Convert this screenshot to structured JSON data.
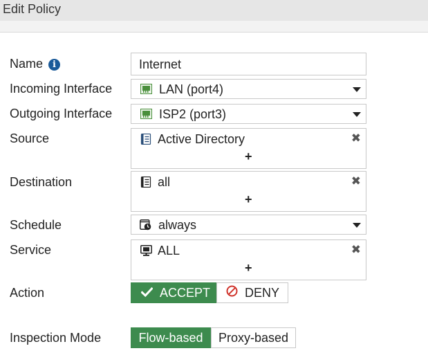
{
  "window": {
    "title": "Edit Policy"
  },
  "form": {
    "name": {
      "label": "Name",
      "icon": "info-icon",
      "value": "Internet"
    },
    "incoming_interface": {
      "label": "Incoming Interface",
      "icon": "network-port-icon",
      "value": "LAN (port4)"
    },
    "outgoing_interface": {
      "label": "Outgoing Interface",
      "icon": "network-port-icon",
      "value": "ISP2 (port3)"
    },
    "source": {
      "label": "Source",
      "icon": "address-book-icon",
      "value": "Active Directory",
      "add_label": "+",
      "remove_label": "✖"
    },
    "destination": {
      "label": "Destination",
      "icon": "address-book-icon",
      "value": "all",
      "add_label": "+",
      "remove_label": "✖"
    },
    "schedule": {
      "label": "Schedule",
      "icon": "schedule-clock-icon",
      "value": "always"
    },
    "service": {
      "label": "Service",
      "icon": "service-monitor-icon",
      "value": "ALL",
      "add_label": "+",
      "remove_label": "✖"
    },
    "action": {
      "label": "Action",
      "options": [
        {
          "label": "ACCEPT",
          "icon": "check-icon",
          "selected": true
        },
        {
          "label": "DENY",
          "icon": "deny-icon",
          "selected": false
        }
      ]
    },
    "inspection_mode": {
      "label": "Inspection Mode",
      "options": [
        {
          "label": "Flow-based",
          "selected": true
        },
        {
          "label": "Proxy-based",
          "selected": false
        }
      ]
    }
  },
  "colors": {
    "accent_green": "#3d8b4e",
    "info_blue": "#1a5a99",
    "deny_red": "#d0342c",
    "port_green": "#4a8f3c"
  }
}
